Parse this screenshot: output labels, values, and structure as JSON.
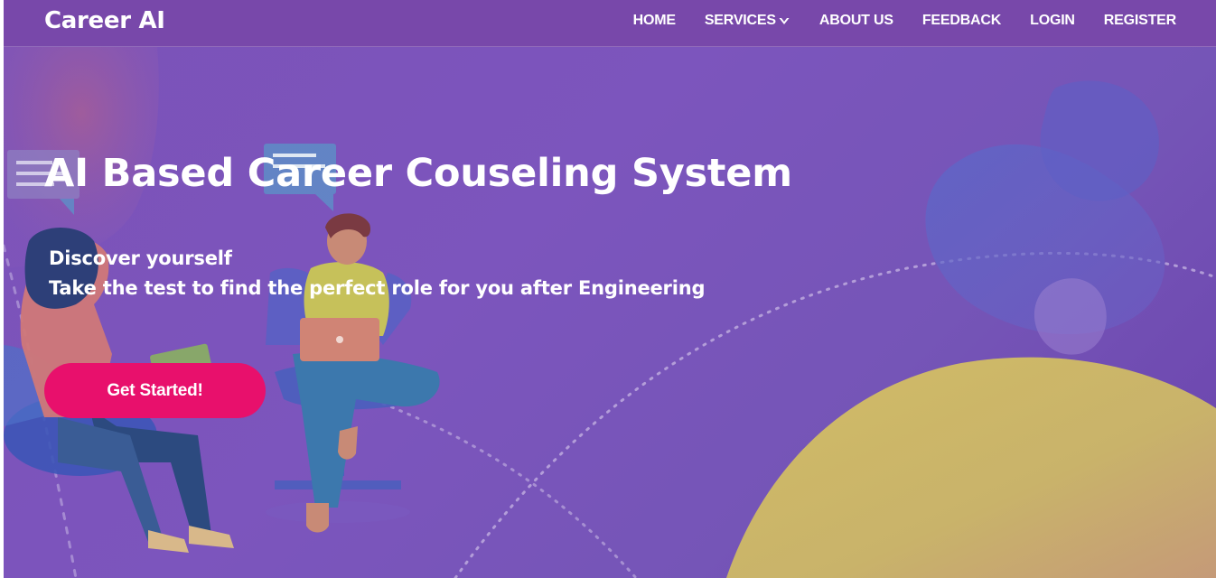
{
  "navbar": {
    "brand": "Career AI",
    "links": [
      {
        "label": "HOME"
      },
      {
        "label": "SERVICES",
        "has_dropdown": true
      },
      {
        "label": "ABOUT US"
      },
      {
        "label": "FEEDBACK"
      },
      {
        "label": "LOGIN"
      },
      {
        "label": "REGISTER"
      }
    ],
    "background_color": "#7848aa"
  },
  "hero": {
    "title": "AI Based Career Couseling System",
    "line1": "Discover yourself",
    "line2": "Take the test to find the perfect role for you after Engineering",
    "cta_label": "Get Started!",
    "cta_color": "#e8106c",
    "background_color": "#7b52b8"
  },
  "icons": {
    "services_caret": "chevron-down-icon"
  }
}
